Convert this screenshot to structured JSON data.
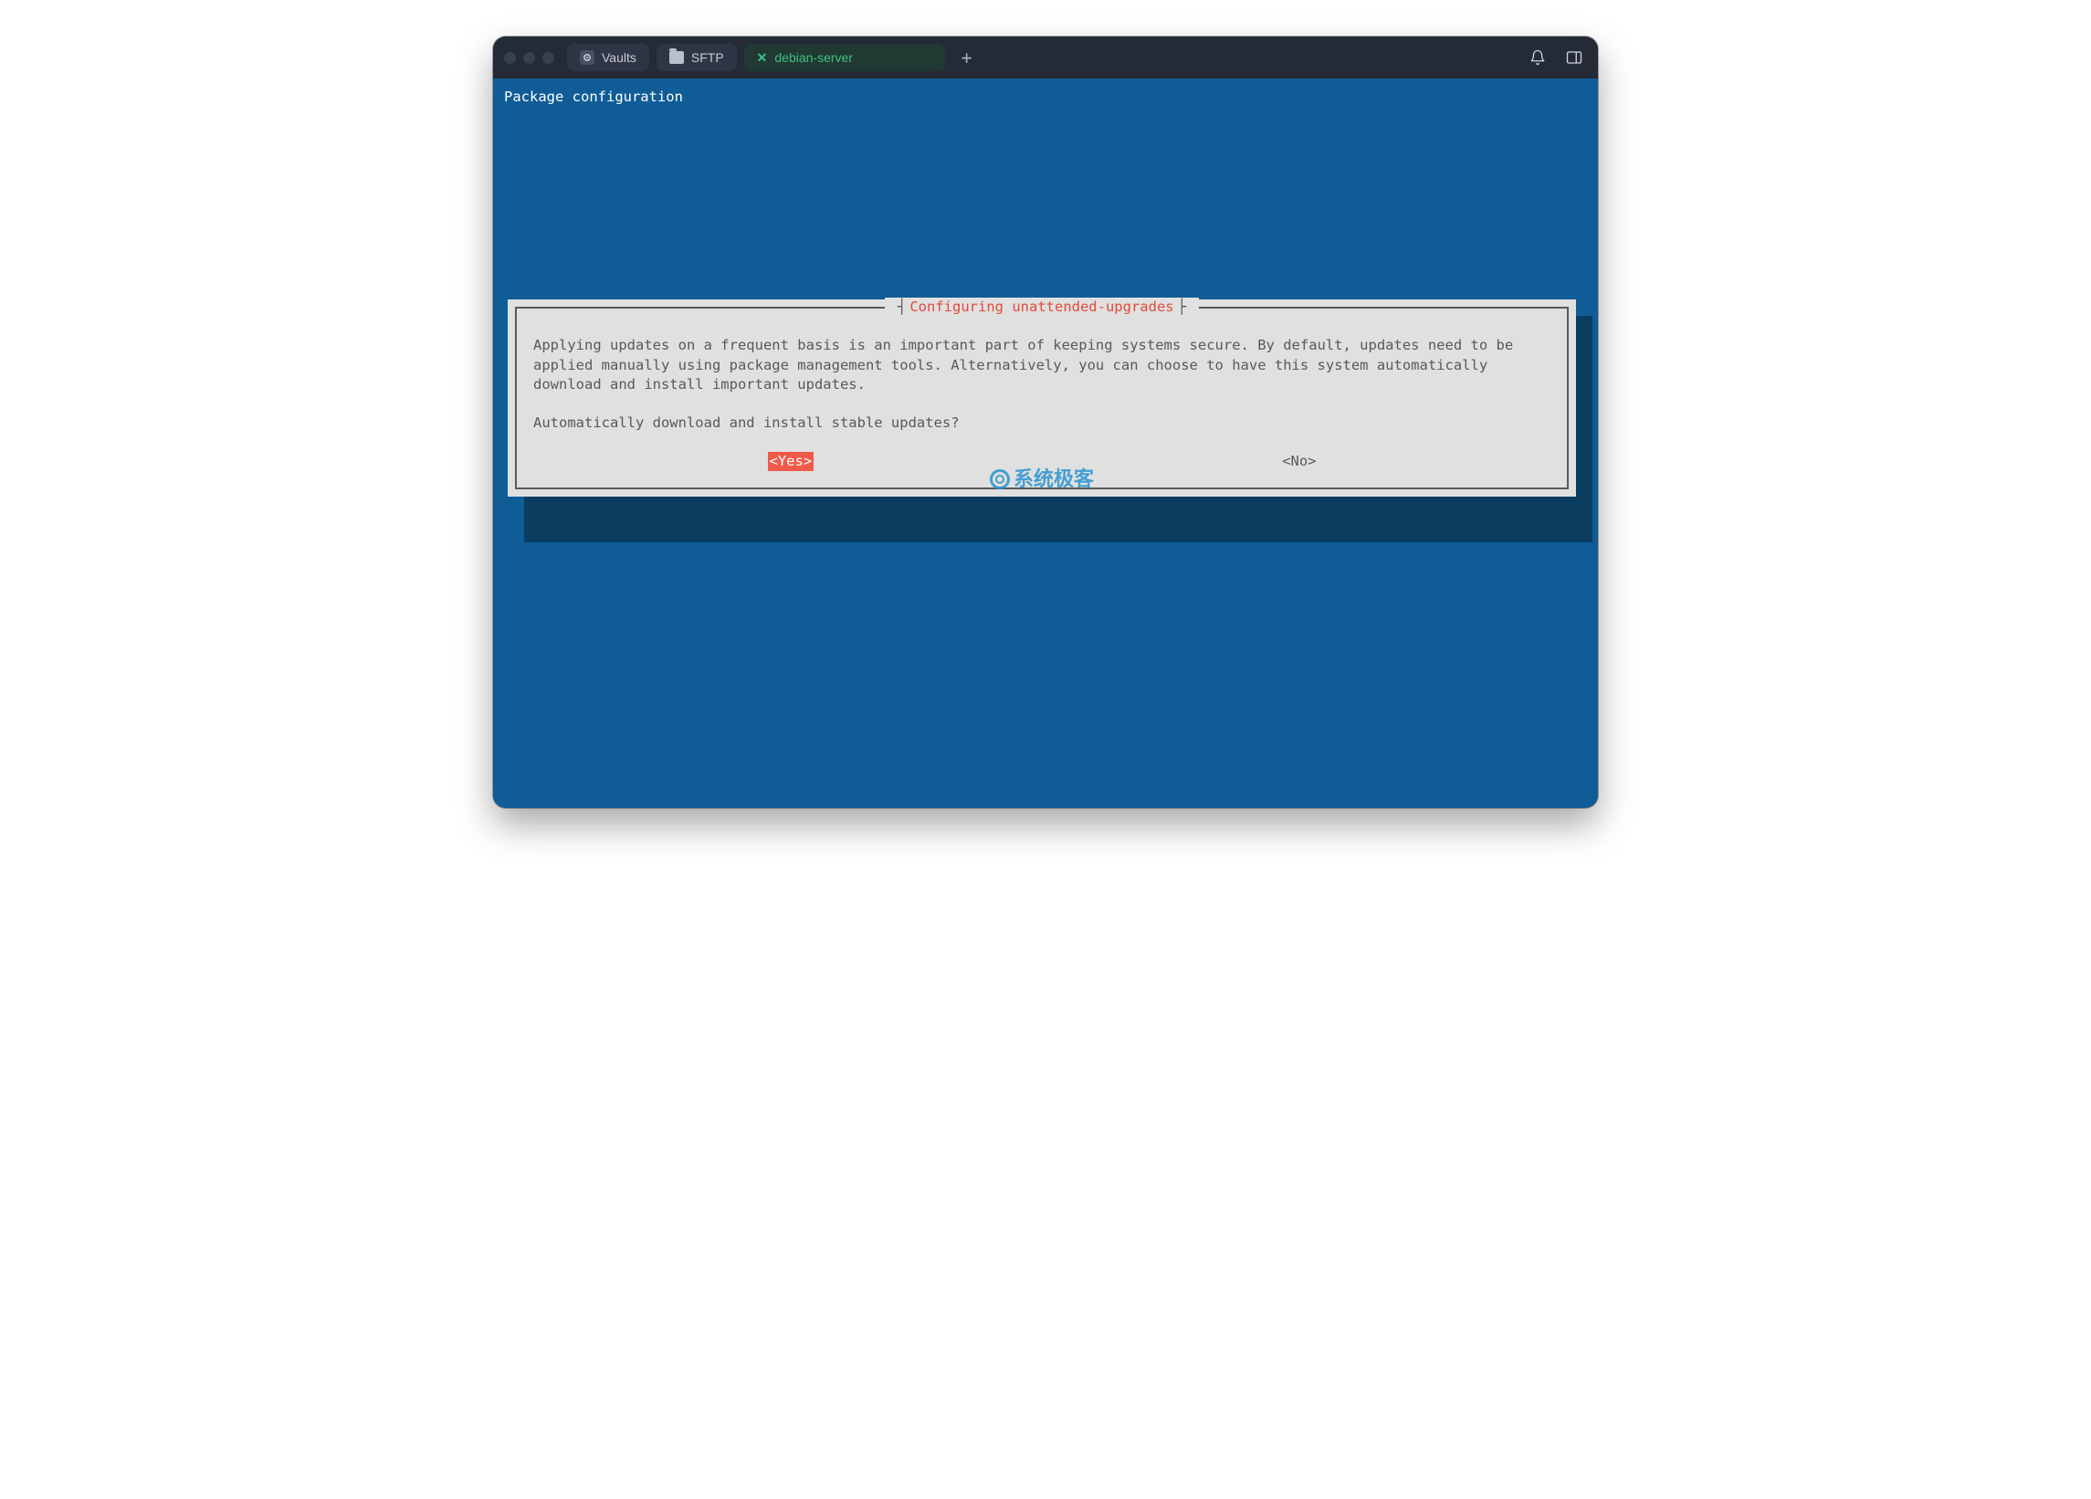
{
  "tabs": {
    "vaults": {
      "label": "Vaults"
    },
    "sftp": {
      "label": "SFTP"
    },
    "active": {
      "label": "debian-server",
      "close": "✕"
    },
    "add": {
      "label": "+"
    }
  },
  "terminal": {
    "header": "Package configuration"
  },
  "dialog": {
    "title": "Configuring unattended-upgrades",
    "paragraph1": "Applying updates on a frequent basis is an important part of keeping systems secure. By default, updates need to be applied manually using package management tools. Alternatively, you can choose to have this system automatically download and install important updates.",
    "paragraph2": "Automatically download and install stable updates?",
    "yes": "<Yes>",
    "no": "<No>"
  },
  "watermark": {
    "text": "系统极客"
  }
}
